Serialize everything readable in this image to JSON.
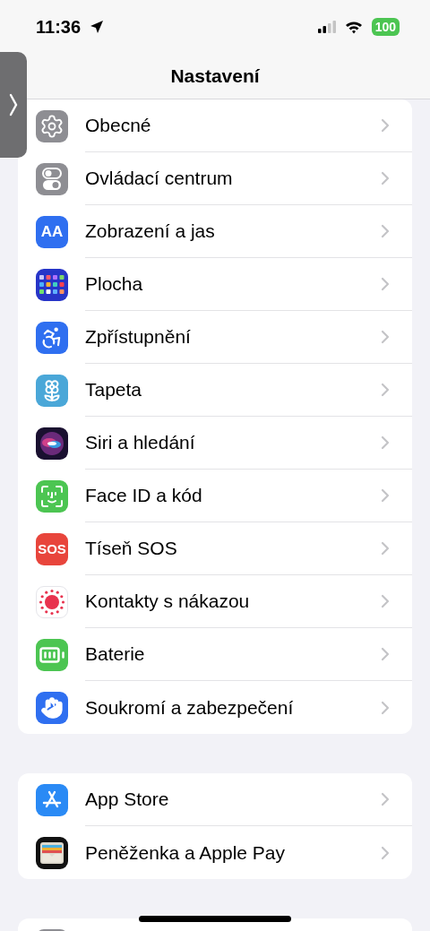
{
  "status_bar": {
    "time": "11:36",
    "battery": "100"
  },
  "title": "Nastavení",
  "groups": [
    {
      "items": [
        {
          "kind": "gear",
          "label": "Obecné"
        },
        {
          "kind": "toggles",
          "label": "Ovládací centrum"
        },
        {
          "kind": "textsize",
          "icon_text": "AA",
          "label": "Zobrazení a jas"
        },
        {
          "kind": "grid",
          "label": "Plocha"
        },
        {
          "kind": "accessibility",
          "label": "Zpřístupnění"
        },
        {
          "kind": "flower",
          "label": "Tapeta"
        },
        {
          "kind": "orb",
          "label": "Siri a hledání"
        },
        {
          "kind": "face",
          "label": "Face ID a kód"
        },
        {
          "kind": "sos",
          "icon_text": "SOS",
          "label": "Tíseň SOS"
        },
        {
          "kind": "exposure",
          "label": "Kontakty s nákazou"
        },
        {
          "kind": "battery",
          "label": "Baterie"
        },
        {
          "kind": "hand",
          "label": "Soukromí a zabezpečení"
        }
      ]
    },
    {
      "items": [
        {
          "kind": "appstore",
          "label": "App Store"
        },
        {
          "kind": "wallet",
          "label": "Peněženka a Apple Pay"
        }
      ]
    },
    {
      "items": [
        {
          "kind": "generic"
        }
      ]
    }
  ]
}
